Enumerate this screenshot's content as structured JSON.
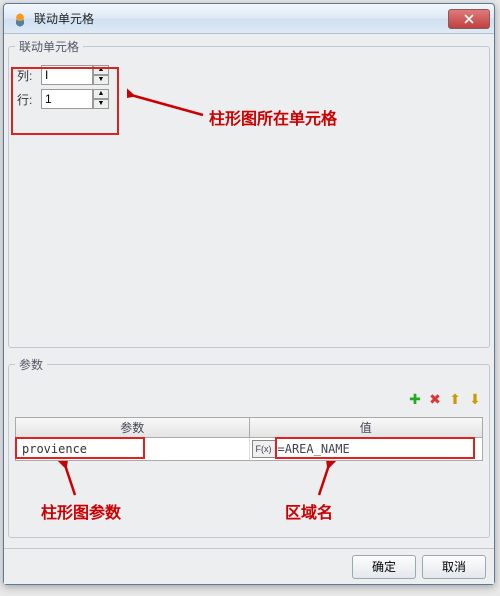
{
  "window": {
    "title": "联动单元格"
  },
  "cells_group": {
    "legend": "联动单元格",
    "column_label": "列:",
    "column_value": "I",
    "row_label": "行:",
    "row_value": "1"
  },
  "params_group": {
    "legend": "参数",
    "header_name": "参数",
    "header_value": "值",
    "rows": [
      {
        "name": "provience",
        "fx": "F(x)",
        "value": "=AREA_NAME"
      }
    ]
  },
  "icons": {
    "plus": "✚",
    "cross": "✖",
    "up": "⬆",
    "down": "⬇",
    "spin_up": "▲",
    "spin_down": "▼"
  },
  "footer": {
    "ok": "确定",
    "cancel": "取消"
  },
  "annotations": {
    "cell_note": "柱形图所在单元格",
    "param_note": "柱形图参数",
    "value_note": "区域名"
  }
}
